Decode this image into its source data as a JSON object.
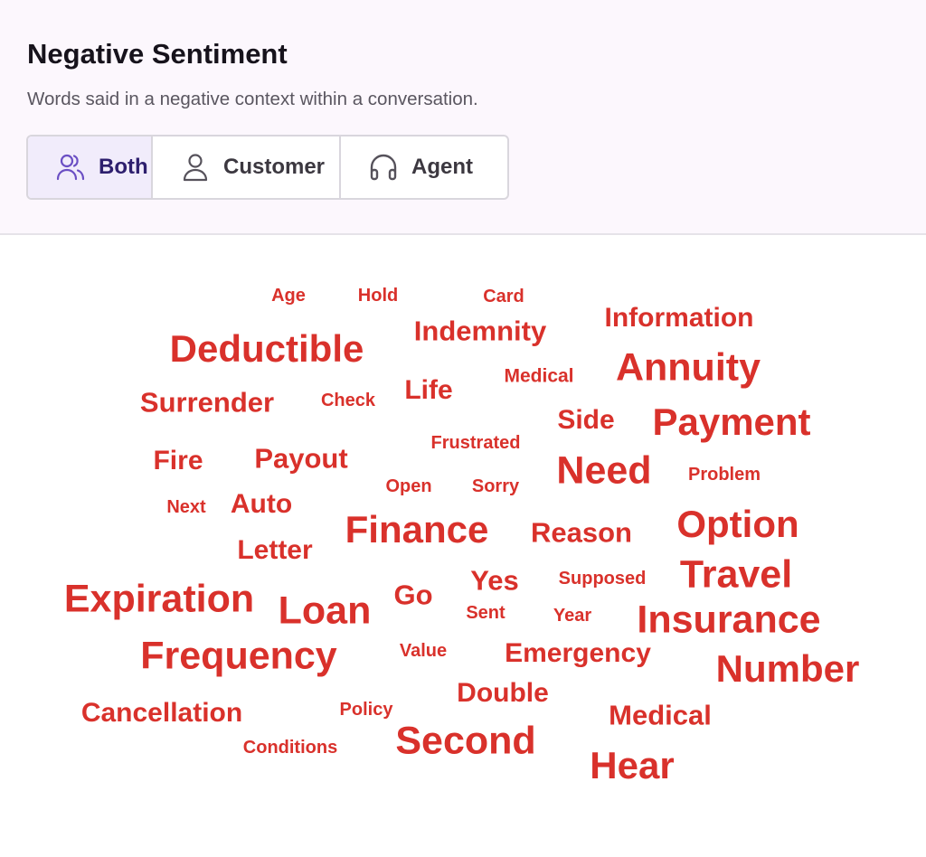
{
  "header": {
    "title": "Negative Sentiment",
    "subtitle": "Words said in a negative context within a conversation."
  },
  "filters": [
    {
      "label": "Both",
      "icon": "users-icon",
      "selected": true
    },
    {
      "label": "Customer",
      "icon": "user-icon",
      "selected": false
    },
    {
      "label": "Agent",
      "icon": "headset-icon",
      "selected": false
    }
  ],
  "word_cloud": {
    "color": "#d9312b",
    "words": [
      "Age",
      "Hold",
      "Card",
      "Indemnity",
      "Information",
      "Deductible",
      "Medical",
      "Annuity",
      "Surrender",
      "Check",
      "Life",
      "Side",
      "Payment",
      "Frustrated",
      "Fire",
      "Payout",
      "Need",
      "Problem",
      "Open",
      "Sorry",
      "Next",
      "Auto",
      "Finance",
      "Reason",
      "Option",
      "Letter",
      "Yes",
      "Supposed",
      "Travel",
      "Expiration",
      "Go",
      "Loan",
      "Sent",
      "Year",
      "Insurance",
      "Frequency",
      "Value",
      "Emergency",
      "Number",
      "Double",
      "Cancellation",
      "Policy",
      "Medical",
      "Second",
      "Conditions",
      "Hear"
    ]
  }
}
